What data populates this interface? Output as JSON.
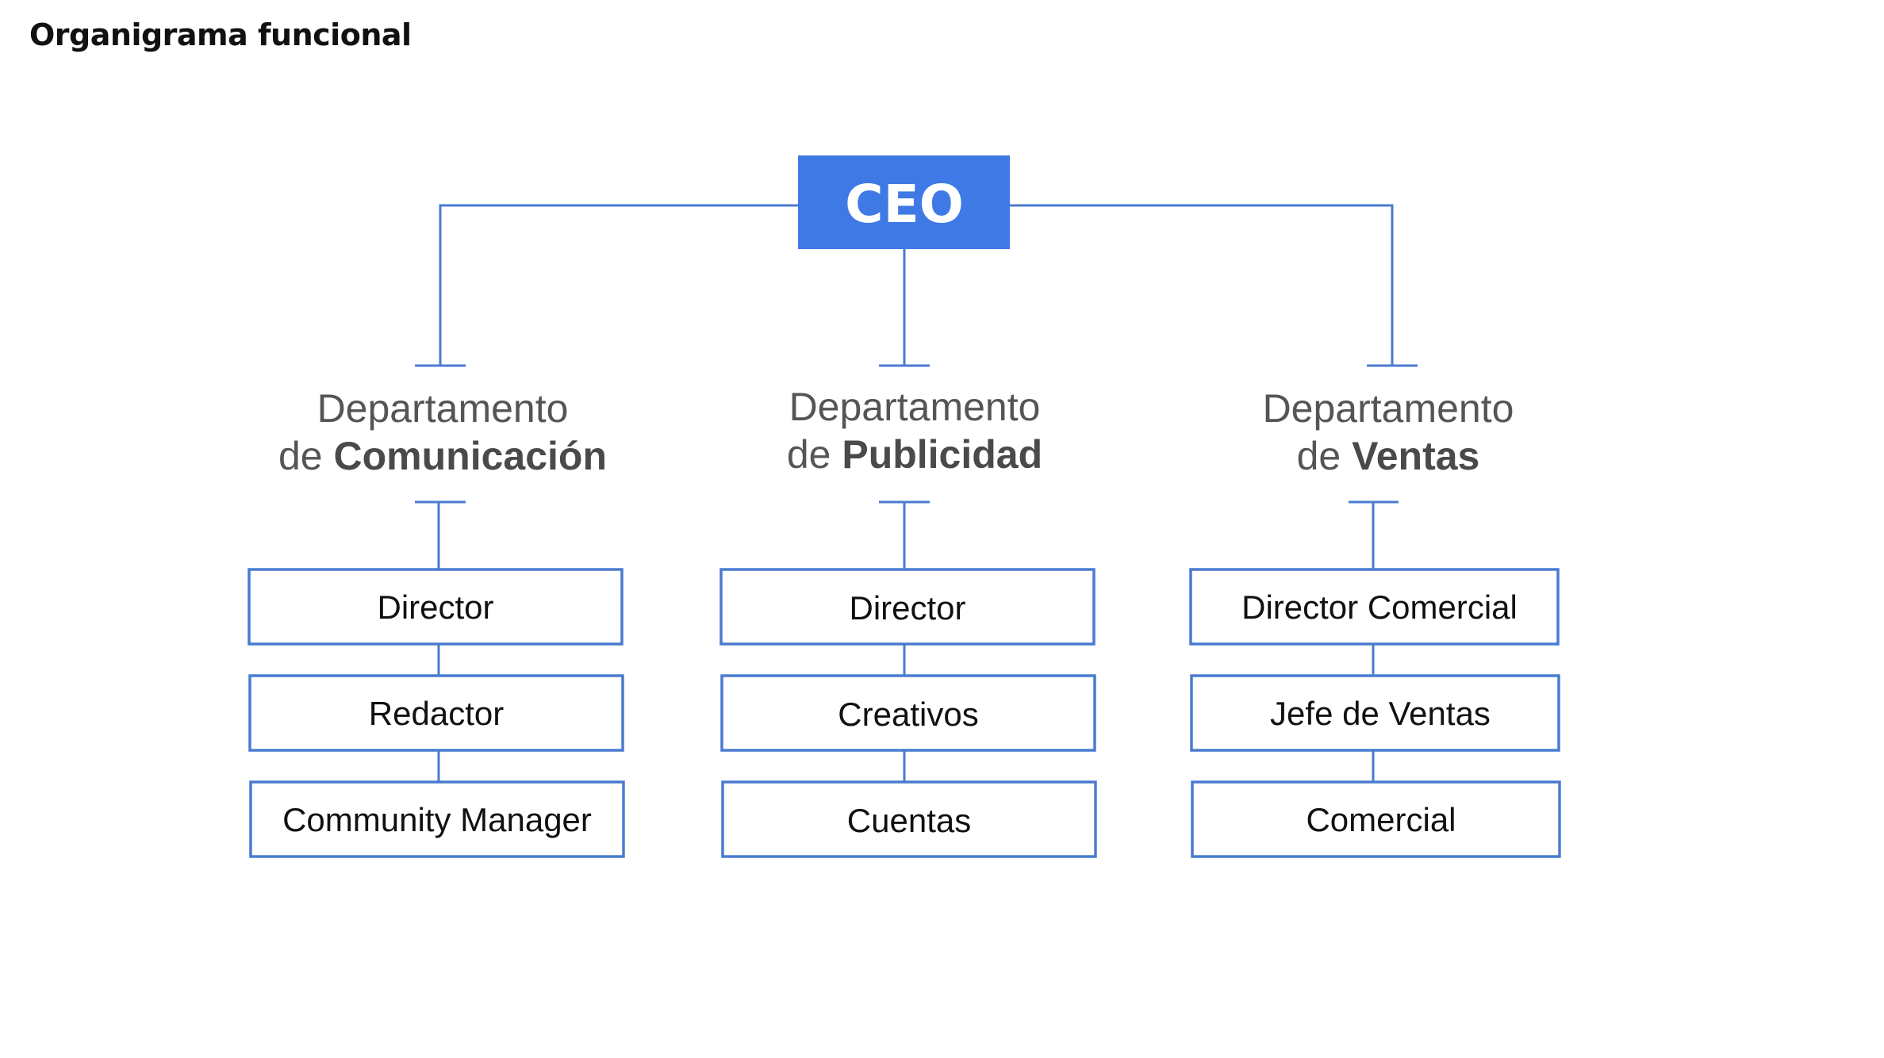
{
  "page": {
    "title": "Organigrama funcional"
  },
  "colors": {
    "accent": "#3f79e6",
    "connector": "#4a7bd0",
    "dept_text": "#555555",
    "role_text": "#111111"
  },
  "org": {
    "root": {
      "label": "CEO"
    },
    "departments": [
      {
        "line1": "Departamento",
        "prefix": "de ",
        "name": "Comunicación",
        "roles": [
          "Director",
          "Redactor",
          "Community Manager"
        ]
      },
      {
        "line1": "Departamento",
        "prefix": "de ",
        "name": "Publicidad",
        "roles": [
          "Director",
          "Creativos",
          "Cuentas"
        ]
      },
      {
        "line1": "Departamento",
        "prefix": "de ",
        "name": "Ventas",
        "roles": [
          "Director Comercial",
          "Jefe de Ventas",
          "Comercial"
        ]
      }
    ]
  }
}
